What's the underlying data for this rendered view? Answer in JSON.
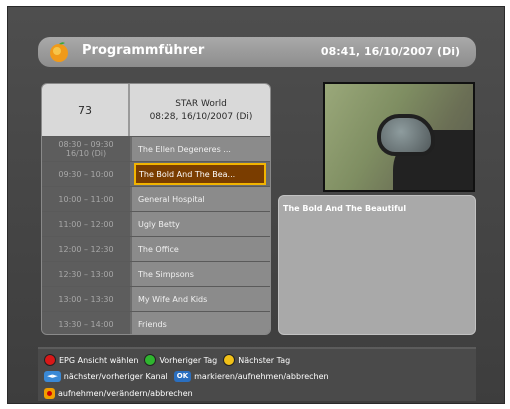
{
  "header": {
    "title": "Programmführer",
    "datetime": "08:41, 16/10/2007 (Di)"
  },
  "channel": {
    "number": "73",
    "name": "STAR World",
    "datetime": "08:28, 16/10/2007 (Di)"
  },
  "programs": [
    {
      "time": "08:30 – 09:30\n16/10 (Di)",
      "title": "The Ellen Degeneres ..."
    },
    {
      "time": "09:30 – 10:00",
      "title": "The Bold And The Bea..."
    },
    {
      "time": "10:00 – 11:00",
      "title": "General Hospital"
    },
    {
      "time": "11:00 – 12:00",
      "title": "Ugly Betty"
    },
    {
      "time": "12:00 – 12:30",
      "title": "The Office"
    },
    {
      "time": "12:30 – 13:00",
      "title": "The Simpsons"
    },
    {
      "time": "13:00 – 13:30",
      "title": "My Wife And Kids"
    },
    {
      "time": "13:30 – 14:00",
      "title": "Friends"
    }
  ],
  "selected_index": 1,
  "description": {
    "title": "The Bold And The Beautiful"
  },
  "footer": {
    "red_label": "EPG Ansicht wählen",
    "green_label": "Vorheriger Tag",
    "yellow_label": "Nächster Tag",
    "channel_key": "◄►",
    "channel_label": "nächster/vorheriger Kanal",
    "ok_key": "OK",
    "ok_label": "markieren/aufnehmen/abbrechen",
    "rec_label": "aufnehmen/verändern/abbrechen"
  },
  "colors": {
    "selection_border": "#f2b400",
    "selection_fill": "#7a3d00",
    "red": "#d81818",
    "green": "#2fb52f",
    "yellow": "#f0c018"
  }
}
